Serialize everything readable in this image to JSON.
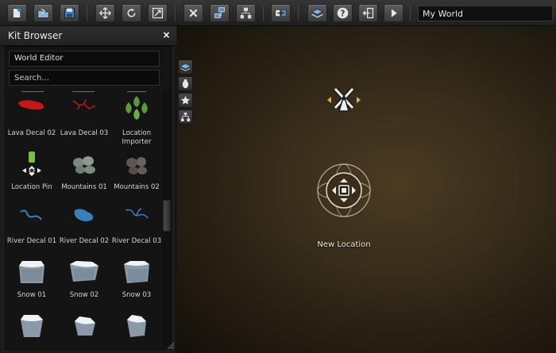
{
  "toolbar": {
    "buttons": [
      {
        "name": "new-world-button",
        "icon": "new-document-icon"
      },
      {
        "name": "open-world-button",
        "icon": "open-folder-icon"
      },
      {
        "name": "save-world-button",
        "icon": "floppy-disk-icon"
      },
      {
        "name": "move-tool-button",
        "icon": "move-arrows-icon"
      },
      {
        "name": "rotate-tool-button",
        "icon": "rotate-icon"
      },
      {
        "name": "scale-tool-button",
        "icon": "scale-icon"
      },
      {
        "name": "delete-button",
        "icon": "close-x-icon"
      },
      {
        "name": "layers-button",
        "icon": "layers-icon"
      },
      {
        "name": "hierarchy-button",
        "icon": "hierarchy-icon"
      },
      {
        "name": "connect-button",
        "icon": "connect-icon"
      },
      {
        "name": "kits-button",
        "icon": "stacked-tiles-icon"
      },
      {
        "name": "help-button",
        "icon": "help-icon"
      },
      {
        "name": "exit-button",
        "icon": "exit-icon"
      },
      {
        "name": "play-button",
        "icon": "play-icon"
      }
    ],
    "world_name": "My World"
  },
  "kit_browser": {
    "title": "Kit Browser",
    "close_label": "×",
    "tag": "World Editor",
    "search_placeholder": "Search...",
    "items": [
      {
        "label": "Lava Decal 02",
        "icon": "lava-decal-icon"
      },
      {
        "label": "Lava Decal 03",
        "icon": "lava-crack-icon"
      },
      {
        "label": "Location Importer",
        "icon": "location-importer-icon"
      },
      {
        "label": "Location Pin",
        "icon": "location-pin-icon"
      },
      {
        "label": "Mountains 01",
        "icon": "mountains-icon"
      },
      {
        "label": "Mountains 02",
        "icon": "mountains-dark-icon"
      },
      {
        "label": "River Decal 01",
        "icon": "river-decal-icon"
      },
      {
        "label": "River Decal 02",
        "icon": "river-pond-icon"
      },
      {
        "label": "River Decal 03",
        "icon": "river-stream-icon"
      },
      {
        "label": "Snow 01",
        "icon": "snow-rock-icon"
      },
      {
        "label": "Snow 02",
        "icon": "snow-rock-icon"
      },
      {
        "label": "Snow 03",
        "icon": "snow-rock-icon"
      },
      {
        "label": "",
        "icon": "snow-rock-icon"
      },
      {
        "label": "",
        "icon": "snow-rock-icon"
      },
      {
        "label": "",
        "icon": "snow-rock-icon"
      }
    ]
  },
  "viewport": {
    "side_tools": [
      {
        "name": "kits-side-button",
        "icon": "stacked-tiles-icon"
      },
      {
        "name": "bugs-side-button",
        "icon": "bug-icon"
      },
      {
        "name": "favorites-side-button",
        "icon": "star-icon"
      },
      {
        "name": "hierarchy-side-button",
        "icon": "hierarchy-icon"
      }
    ],
    "windmill_marker_icon": "windmill-icon",
    "new_location_label": "New Location"
  },
  "colors": {
    "viewport_center": "#4a3b22",
    "viewport_edge": "#140f09",
    "lava": "#c4171b",
    "river": "#3b7fb8",
    "pin_green": "#7ac043",
    "importer_green": "#5a9a3a"
  }
}
